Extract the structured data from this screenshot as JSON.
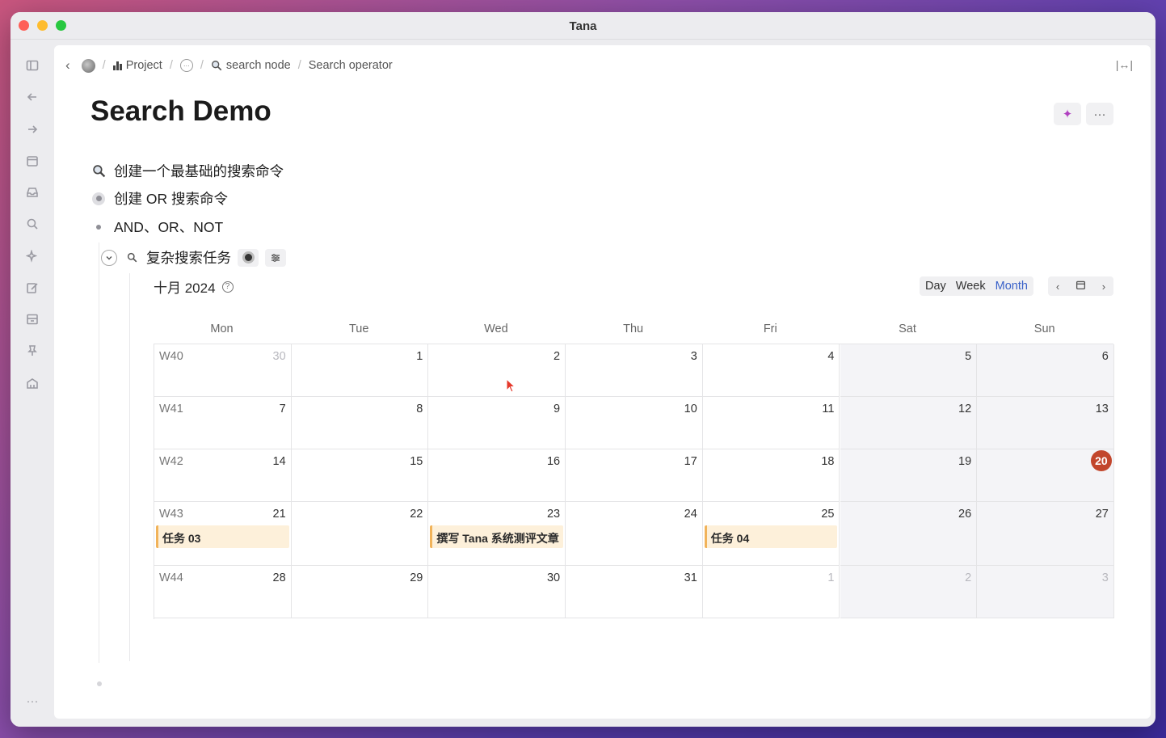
{
  "window": {
    "title": "Tana"
  },
  "sidebar": {
    "icons": [
      "sidebar-toggle-icon",
      "back-arrow-icon",
      "forward-arrow-icon",
      "calendar-icon",
      "inbox-icon",
      "search-icon",
      "sparkle-icon",
      "edit-icon",
      "archive-icon",
      "pin-icon",
      "home-icon",
      "more-icon"
    ],
    "more_label": "···"
  },
  "breadcrumb": {
    "back": "‹",
    "items": [
      "Project",
      "search node",
      "Search operator"
    ],
    "ellipsis": "···",
    "separator": "/"
  },
  "header": {
    "title": "Search Demo",
    "more_label": "···",
    "ai_label": "✦"
  },
  "outline": [
    {
      "text": "创建一个最基础的搜索命令",
      "type": "search"
    },
    {
      "text": "创建 OR 搜索命令",
      "type": "ring"
    },
    {
      "text": "AND、OR、NOT",
      "type": "dot"
    }
  ],
  "search_node": {
    "title": "复杂搜索任务"
  },
  "calendar": {
    "month_label": "十月 2024",
    "help": "?",
    "views": [
      "Day",
      "Week",
      "Month"
    ],
    "active_view": "Month",
    "nav": {
      "prev": "‹",
      "next": "›"
    },
    "weekdays": [
      "Mon",
      "Tue",
      "Wed",
      "Thu",
      "Fri",
      "Sat",
      "Sun"
    ],
    "weeks": [
      {
        "label": "W40",
        "days": [
          "30",
          "1",
          "2",
          "3",
          "4",
          "5",
          "6"
        ],
        "other": [
          true,
          false,
          false,
          false,
          false,
          false,
          false
        ]
      },
      {
        "label": "W41",
        "days": [
          "7",
          "8",
          "9",
          "10",
          "11",
          "12",
          "13"
        ],
        "other": [
          false,
          false,
          false,
          false,
          false,
          false,
          false
        ]
      },
      {
        "label": "W42",
        "days": [
          "14",
          "15",
          "16",
          "17",
          "18",
          "19",
          "20"
        ],
        "other": [
          false,
          false,
          false,
          false,
          false,
          false,
          false
        ]
      },
      {
        "label": "W43",
        "days": [
          "21",
          "22",
          "23",
          "24",
          "25",
          "26",
          "27"
        ],
        "other": [
          false,
          false,
          false,
          false,
          false,
          false,
          false
        ]
      },
      {
        "label": "W44",
        "days": [
          "28",
          "29",
          "30",
          "31",
          "1",
          "2",
          "3"
        ],
        "other": [
          false,
          false,
          false,
          false,
          true,
          true,
          true
        ]
      }
    ],
    "today": "20",
    "events": [
      {
        "week": 3,
        "day": 0,
        "title": "任务 03"
      },
      {
        "week": 3,
        "day": 2,
        "title": "撰写 Tana 系统测评文章"
      },
      {
        "week": 3,
        "day": 4,
        "title": "任务 04"
      }
    ],
    "colors": {
      "today": "#c2462c",
      "event_bg": "#fdf0da",
      "event_border": "#f1b35a",
      "active_view": "#3a62c9"
    }
  }
}
